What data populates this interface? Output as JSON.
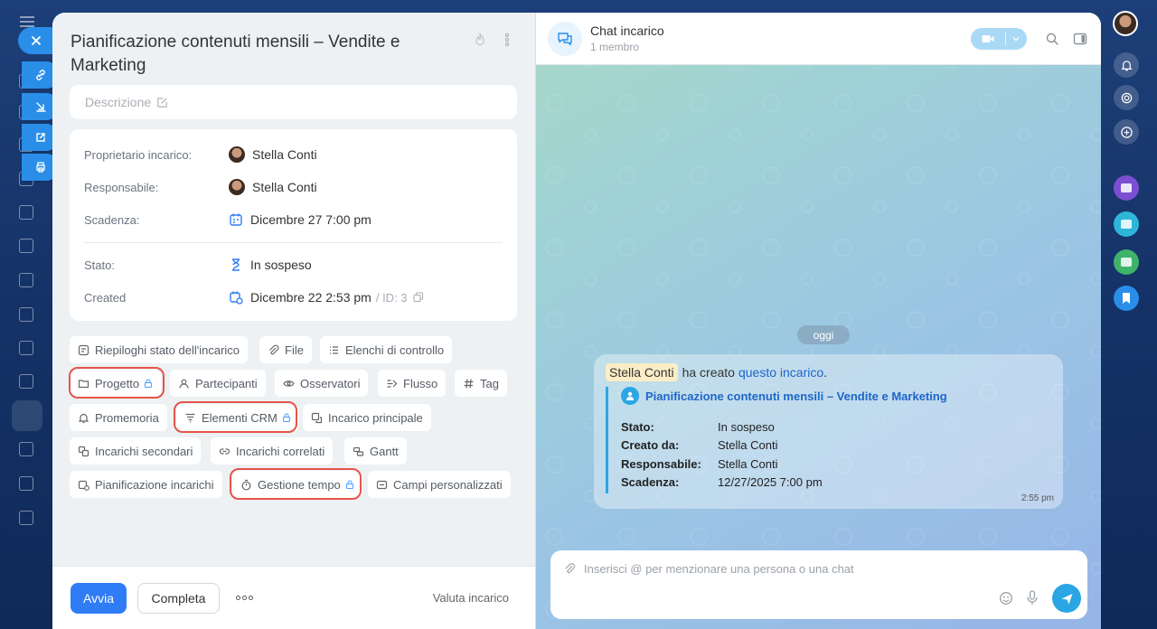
{
  "task": {
    "title": "Pianificazione contenuti mensili – Vendite e Marketing",
    "description_placeholder": "Descrizione",
    "fields": {
      "owner_label": "Proprietario incarico:",
      "owner_value": "Stella Conti",
      "responsible_label": "Responsabile:",
      "responsible_value": "Stella Conti",
      "deadline_label": "Scadenza:",
      "deadline_value": "Dicembre 27 7:00 pm",
      "status_label": "Stato:",
      "status_value": "In sospeso",
      "created_label": "Created",
      "created_value": "Dicembre 22 2:53 pm",
      "id_value": "/ ID: 3"
    },
    "chips": {
      "summaries": "Riepiloghi stato dell'incarico",
      "files": "File",
      "checklists": "Elenchi di controllo",
      "project": "Progetto",
      "participants": "Partecipanti",
      "observers": "Osservatori",
      "flow": "Flusso",
      "tag": "Tag",
      "reminder": "Promemoria",
      "crm": "Elementi CRM",
      "parent_task": "Incarico principale",
      "subtasks": "Incarichi secondari",
      "related": "Incarichi correlati",
      "gantt": "Gantt",
      "planning": "Pianificazione incarichi",
      "time_tracking": "Gestione tempo",
      "custom_fields": "Campi personalizzati"
    },
    "footer": {
      "start": "Avvia",
      "complete": "Completa",
      "rate": "Valuta incarico"
    }
  },
  "chat": {
    "title": "Chat incarico",
    "subtitle": "1 membro",
    "date_badge": "oggi",
    "message": {
      "mention": "Stella Conti",
      "text": "ha creato",
      "link": "questo incarico",
      "period": ".",
      "quote_title": "Pianificazione contenuti mensili – Vendite e Marketing",
      "rows": [
        {
          "k": "Stato:",
          "v": "In sospeso"
        },
        {
          "k": "Creato da:",
          "v": "Stella Conti"
        },
        {
          "k": "Responsabile:",
          "v": "Stella Conti"
        },
        {
          "k": "Scadenza:",
          "v": "12/27/2025 7:00 pm"
        }
      ],
      "time": "2:55 pm"
    },
    "composer_placeholder": "Inserisci @ per menzionare una persona o una chat"
  },
  "colors": {
    "accent": "#2f7df6",
    "highlight": "#e7534a",
    "chat_blue": "#2aa6e5"
  }
}
